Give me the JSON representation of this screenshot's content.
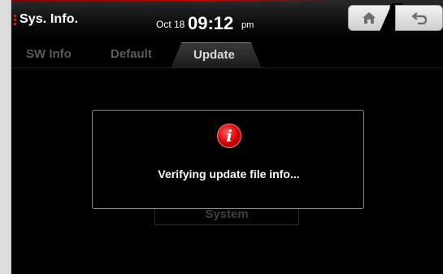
{
  "header": {
    "title": "Sys. Info.",
    "date": "Oct 18",
    "time": "09:12",
    "ampm": "pm",
    "home_icon": "home-icon",
    "back_icon": "back-arrow-icon"
  },
  "tabs": [
    {
      "label": "SW Info",
      "active": false
    },
    {
      "label": "Default",
      "active": false
    },
    {
      "label": "Update",
      "active": true
    }
  ],
  "background": {
    "system_button_label": "System"
  },
  "dialog": {
    "icon": "info-icon",
    "icon_glyph": "i",
    "message": "Verifying update file info..."
  },
  "colors": {
    "accent_red": "#d10000",
    "background": "#000000"
  }
}
